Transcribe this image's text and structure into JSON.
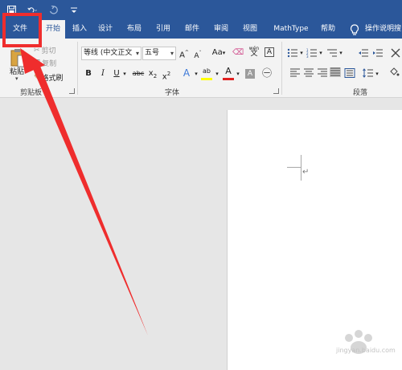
{
  "quick_access": {
    "save_icon": "save-icon",
    "undo_icon": "undo-icon",
    "redo_icon": "redo-icon",
    "customize_icon": "customize-dropdown-icon"
  },
  "tabs": [
    {
      "label": "文件"
    },
    {
      "label": "开始"
    },
    {
      "label": "插入"
    },
    {
      "label": "设计"
    },
    {
      "label": "布局"
    },
    {
      "label": "引用"
    },
    {
      "label": "邮件"
    },
    {
      "label": "审阅"
    },
    {
      "label": "视图"
    },
    {
      "label": "MathType"
    },
    {
      "label": "帮助"
    }
  ],
  "tell_me": {
    "label": "操作说明搜"
  },
  "clipboard": {
    "paste_label": "粘贴",
    "cut_label": "剪切",
    "copy_label": "复制",
    "format_painter_label": "格式刷",
    "group_label": "剪贴板"
  },
  "font": {
    "font_name": "等线 (中文正文",
    "font_size": "五号",
    "group_label": "字体",
    "grow_label": "A",
    "shrink_label": "A",
    "case_label": "Aa",
    "bold_label": "B",
    "italic_label": "I",
    "underline_label": "U",
    "strike_label": "abc",
    "subscript_label": "x",
    "superscript_label": "x",
    "sub_mark": "2",
    "sup_mark": "2",
    "text_effects_label": "A",
    "highlight_label": "ab",
    "font_color_label": "A",
    "shading_label": "A",
    "char_border_label": "A",
    "phonetic_label": "wén",
    "highlight_color": "#ffff00",
    "font_color": "#e02020"
  },
  "paragraph": {
    "group_label": "段落"
  },
  "annotation": {
    "color": "#ef2d2d"
  },
  "watermark": {
    "text": "jingyan.baidu.com"
  }
}
